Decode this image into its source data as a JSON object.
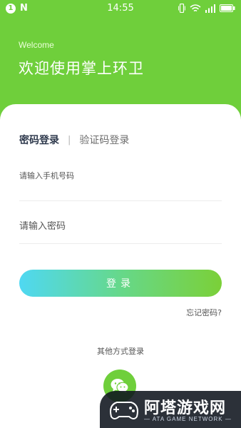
{
  "status_bar": {
    "notification_count": "1",
    "app_badge": "N",
    "time": "14:55",
    "icons": [
      "vibrate-icon",
      "wifi-icon",
      "signal-icon",
      "battery-icon"
    ]
  },
  "header": {
    "welcome_en": "Welcome",
    "welcome_cn": "欢迎使用掌上环卫",
    "background_color": "#6fcf3b"
  },
  "tabs": {
    "active_label": "密码登录",
    "separator": "|",
    "inactive_label": "验证码登录"
  },
  "form": {
    "phone_placeholder": "请输入手机号码",
    "password_placeholder": "请输入密码",
    "login_label": "登录",
    "forgot_label": "忘记密码?"
  },
  "other_login": {
    "label": "其他方式登录",
    "wechat_icon": "wechat-icon"
  },
  "watermark": {
    "title": "阿塔游戏网",
    "subtitle": "— ATA GAME NETWORK —"
  },
  "colors": {
    "accent_green": "#6fcf3b",
    "gradient_start": "#4fd8f2",
    "gradient_end": "#7bd038"
  }
}
